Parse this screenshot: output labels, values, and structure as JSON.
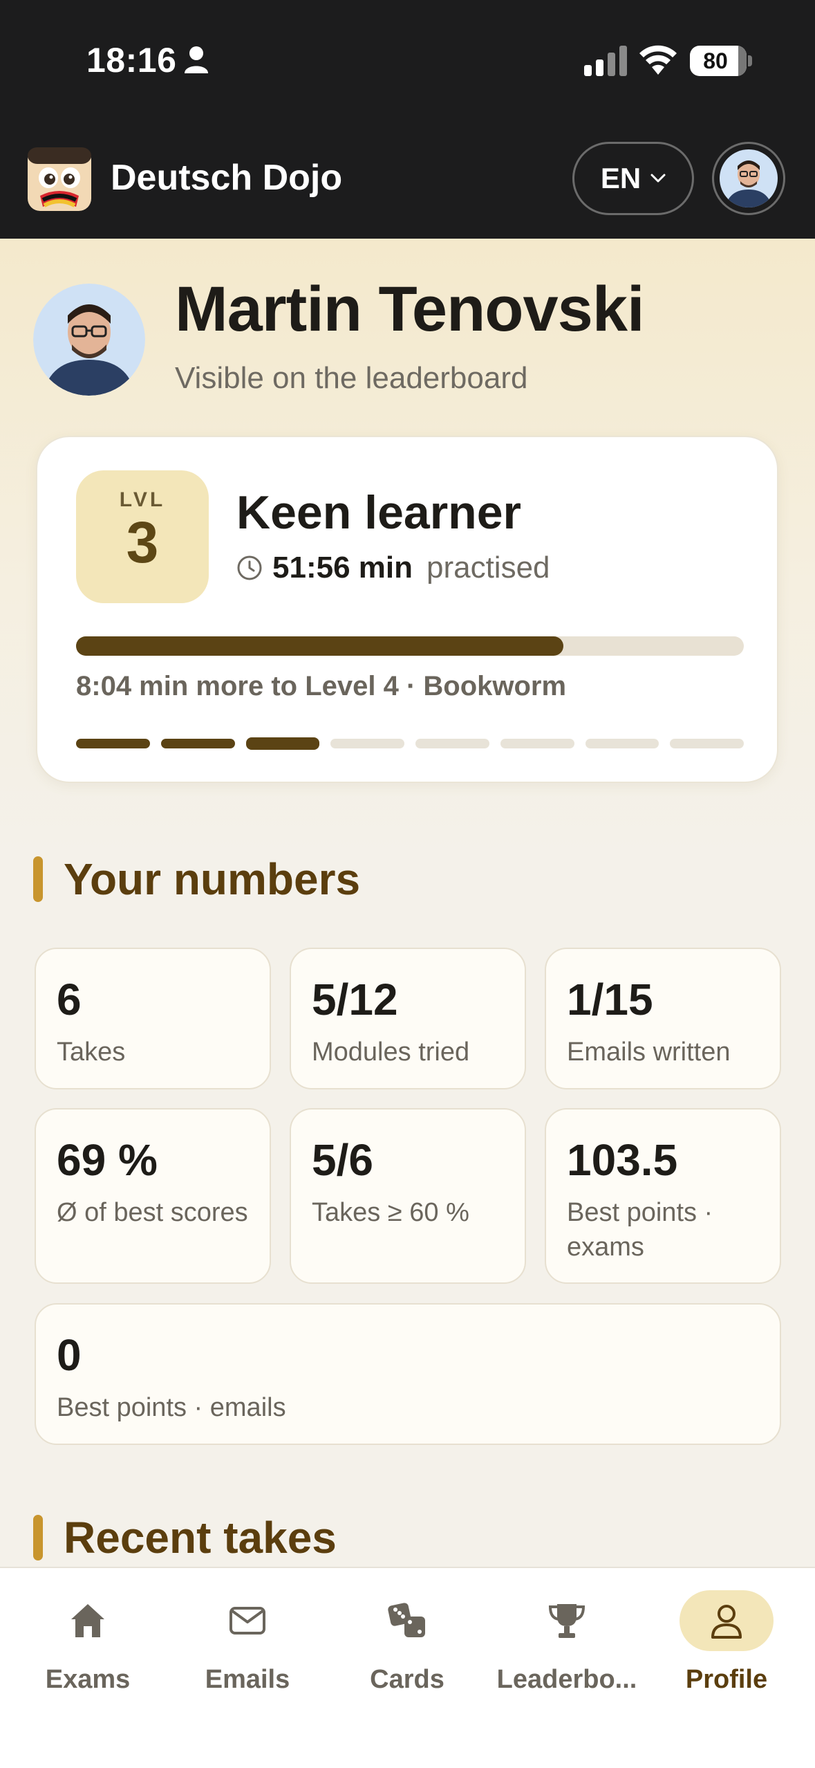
{
  "status_bar": {
    "time": "18:16",
    "battery": "80"
  },
  "header": {
    "app_title": "Deutsch Dojo",
    "language": "EN"
  },
  "profile": {
    "name": "Martin Tenovski",
    "visibility": "Visible on the leaderboard"
  },
  "level_card": {
    "level_label": "LVL",
    "level_number": "3",
    "rank_title": "Keen learner",
    "practice_time": "51:56 min",
    "practice_label": "practised",
    "progress_fraction": 0.73,
    "progress_text": "8:04 min more to Level 4 · Bookworm",
    "levels_total": 8,
    "levels_completed": 3
  },
  "numbers_section": {
    "title": "Your numbers",
    "stats": [
      {
        "value": "6",
        "label": "Takes"
      },
      {
        "value": "5/12",
        "label": "Modules tried"
      },
      {
        "value": "1/15",
        "label": "Emails written"
      },
      {
        "value": "69 %",
        "label": "Ø of best scores"
      },
      {
        "value": "5/6",
        "label": "Takes ≥ 60 %"
      },
      {
        "value": "103.5",
        "label": "Best points · exams"
      },
      {
        "value": "0",
        "label": "Best points · emails"
      }
    ]
  },
  "recent_section": {
    "title": "Recent takes"
  },
  "bottom_nav": {
    "items": [
      {
        "label": "Exams",
        "icon": "home-icon"
      },
      {
        "label": "Emails",
        "icon": "mail-icon"
      },
      {
        "label": "Cards",
        "icon": "dice-icon"
      },
      {
        "label": "Leaderbo...",
        "icon": "trophy-icon"
      },
      {
        "label": "Profile",
        "icon": "person-icon",
        "active": true
      }
    ]
  },
  "colors": {
    "accent_dark": "#5b4314",
    "accent_gold": "#c8952e",
    "badge_bg": "#f3e6b9",
    "header_bg": "#1c1c1d"
  }
}
